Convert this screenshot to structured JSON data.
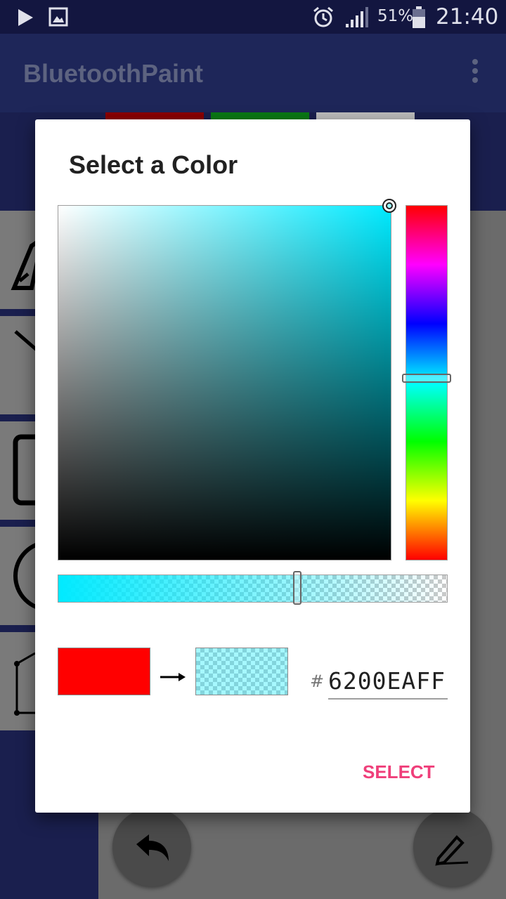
{
  "status_bar": {
    "battery_percent": "51%",
    "time": "21:40",
    "icons": [
      "play-store-icon",
      "gallery-icon",
      "alarm-icon",
      "signal-icon",
      "battery-icon"
    ]
  },
  "app_bar": {
    "title": "BluetoothPaint",
    "overflow_icon": "more-vert-icon"
  },
  "palette": {
    "colors": [
      "#8b0000",
      "#0a7a14",
      "#bdbdbd"
    ]
  },
  "tools": [
    "brush-icon",
    "line-icon",
    "rectangle-icon",
    "circle-icon",
    "polygon-icon"
  ],
  "fabs": [
    "undo-icon",
    "edit-icon"
  ],
  "dialog": {
    "title": "Select a Color",
    "hue_color": "#00eaff",
    "old_color": "#ff0000",
    "hex_prefix": "#",
    "hex_value": "6200EAFF",
    "select_label": "SELECT",
    "accent_color": "#ef3f7a"
  }
}
